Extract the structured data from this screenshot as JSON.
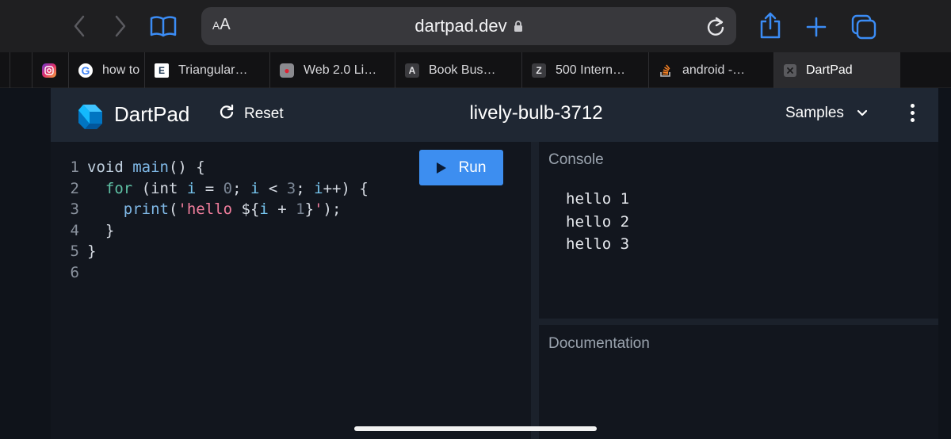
{
  "browser": {
    "url": "dartpad.dev",
    "aa_label": "AA",
    "tabs": [
      {
        "label": "",
        "icon": "instagram-icon"
      },
      {
        "label": "how to",
        "icon": "google-icon"
      },
      {
        "label": "Triangular…",
        "icon": "e-icon"
      },
      {
        "label": "Web 2.0 Li…",
        "icon": "robot-icon"
      },
      {
        "label": "Book Bus…",
        "icon": "a-icon"
      },
      {
        "label": "500 Intern…",
        "icon": "z-icon"
      },
      {
        "label": "android -…",
        "icon": "stackoverflow-icon"
      },
      {
        "label": "DartPad",
        "icon": "close-icon"
      }
    ]
  },
  "dartpad": {
    "title": "DartPad",
    "reset_label": "Reset",
    "pad_name": "lively-bulb-3712",
    "samples_label": "Samples",
    "run_label": "Run",
    "console_label": "Console",
    "documentation_label": "Documentation",
    "line_numbers": [
      "1",
      "2",
      "3",
      "4",
      "5",
      "6"
    ],
    "code": {
      "l1": {
        "kw": "void",
        "fn": "main",
        "rest": "() {"
      },
      "l2": {
        "ctl": "for",
        "a": " (int ",
        "v1": "i",
        "b": " = ",
        "n0": "0",
        "c": "; ",
        "v2": "i",
        "d": " < ",
        "n3": "3",
        "e": "; ",
        "v3": "i",
        "f": "++) {"
      },
      "l3": {
        "fn": "print",
        "a": "(",
        "s1": "'hello ",
        "b": "${",
        "v": "i",
        "c": " + ",
        "n": "1",
        "d": "}",
        "s2": "'",
        "e": ");"
      },
      "l4": "}",
      "l5": "}"
    },
    "console_output": [
      "hello 1",
      "hello 2",
      "hello 3"
    ]
  },
  "colors": {
    "accent": "#3d8ef0",
    "header_bg": "#1f2733",
    "editor_bg": "#12161e"
  }
}
